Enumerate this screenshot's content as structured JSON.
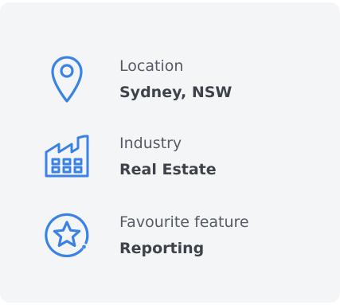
{
  "colors": {
    "accent": "#3b82e6",
    "card_background": "#f4f5f7",
    "label_text": "#555b66",
    "value_text": "#3d424b"
  },
  "details": {
    "items": [
      {
        "icon": "location-pin-icon",
        "label": "Location",
        "value": "Sydney, NSW"
      },
      {
        "icon": "factory-icon",
        "label": "Industry",
        "value": "Real Estate"
      },
      {
        "icon": "star-badge-icon",
        "label": "Favourite feature",
        "value": "Reporting"
      }
    ]
  }
}
